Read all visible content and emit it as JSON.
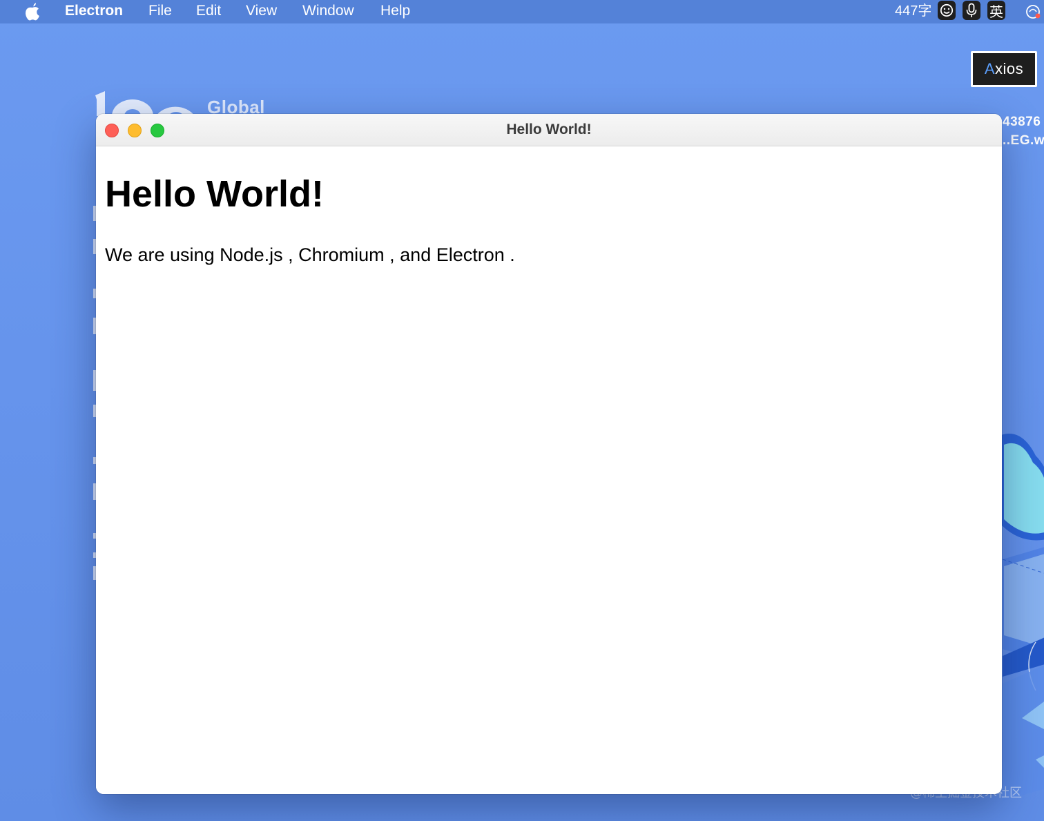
{
  "menubar": {
    "apple_icon": "apple-logo-icon",
    "app_name": "Electron",
    "menus": [
      "File",
      "Edit",
      "View",
      "Window",
      "Help"
    ],
    "status": {
      "word_count": "447字",
      "emoji_icon": "smiley-icon",
      "mic_icon": "microphone-icon",
      "input_source": "英",
      "control_icon": "control-center-icon"
    }
  },
  "desktop": {
    "wallpaper_text": "Global",
    "right_labels": [
      "43876",
      "..EG.w"
    ],
    "icons": [
      {
        "label": "Axios",
        "accent_letter": "A",
        "rest": "xios",
        "accent_color": "#5a9cf8"
      }
    ],
    "watermark": "@稀土掘金技术社区"
  },
  "window": {
    "title": "Hello World!",
    "controls": [
      "close",
      "minimize",
      "zoom"
    ],
    "content": {
      "heading": "Hello World!",
      "paragraph": "We are using Node.js , Chromium , and Electron ."
    }
  },
  "colors": {
    "desktop_background": "#6a98ee",
    "menubar": "#5280d6",
    "traffic_close": "#fe5f57",
    "traffic_minimize": "#febc2e",
    "traffic_zoom": "#28c840"
  }
}
